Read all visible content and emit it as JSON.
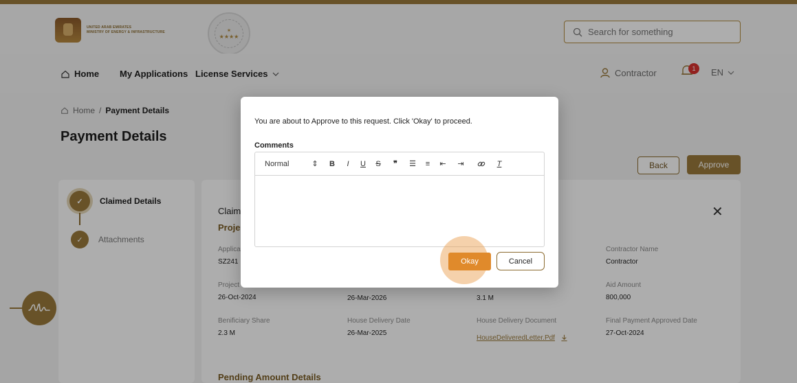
{
  "header": {
    "org_line1": "UNITED ARAB EMIRATES",
    "org_line2": "MINISTRY OF ENERGY & INFRASTRUCTURE",
    "search_placeholder": "Search for something"
  },
  "nav": {
    "home": "Home",
    "my_applications": "My Applications",
    "license_services": "License Services",
    "user": "Contractor",
    "notification_count": "1",
    "language": "EN"
  },
  "breadcrumb": {
    "home": "Home",
    "separator": "/",
    "current": "Payment Details"
  },
  "page": {
    "title": "Payment Details",
    "back_label": "Back",
    "approve_label": "Approve"
  },
  "steps": [
    {
      "label": "Claimed Details"
    },
    {
      "label": "Attachments"
    }
  ],
  "card": {
    "title_partial": "Claim",
    "subtitle_partial": "Proje",
    "fields": [
      {
        "label": "Applica",
        "value": "SZ241"
      },
      {
        "label": "Contractor Name",
        "value": "Contractor"
      },
      {
        "label": "Project",
        "value": "26-Oct-2024"
      },
      {
        "label": "",
        "value": "26-Mar-2026"
      },
      {
        "label": "",
        "value": "3.1 M"
      },
      {
        "label": "Aid Amount",
        "value": "800,000"
      },
      {
        "label": "Benificiary Share",
        "value": "2.3 M"
      },
      {
        "label": "House Delivery Date",
        "value": "26-Mar-2025"
      },
      {
        "label": "House Delivery Document",
        "value": "HouseDeliveredLetter.Pdf"
      },
      {
        "label": "Final Payment Approved Date",
        "value": "27-Oct-2024"
      }
    ],
    "pending_title": "Pending Amount Details"
  },
  "modal": {
    "message": "You are about to Approve to this request. Click 'Okay' to proceed.",
    "comments_label": "Comments",
    "toolbar_format": "Normal",
    "okay_label": "Okay",
    "cancel_label": "Cancel"
  },
  "colors": {
    "brand_gold": "#9a7a3c",
    "okay_orange": "#e08a2b",
    "badge_red": "#d8322f"
  }
}
